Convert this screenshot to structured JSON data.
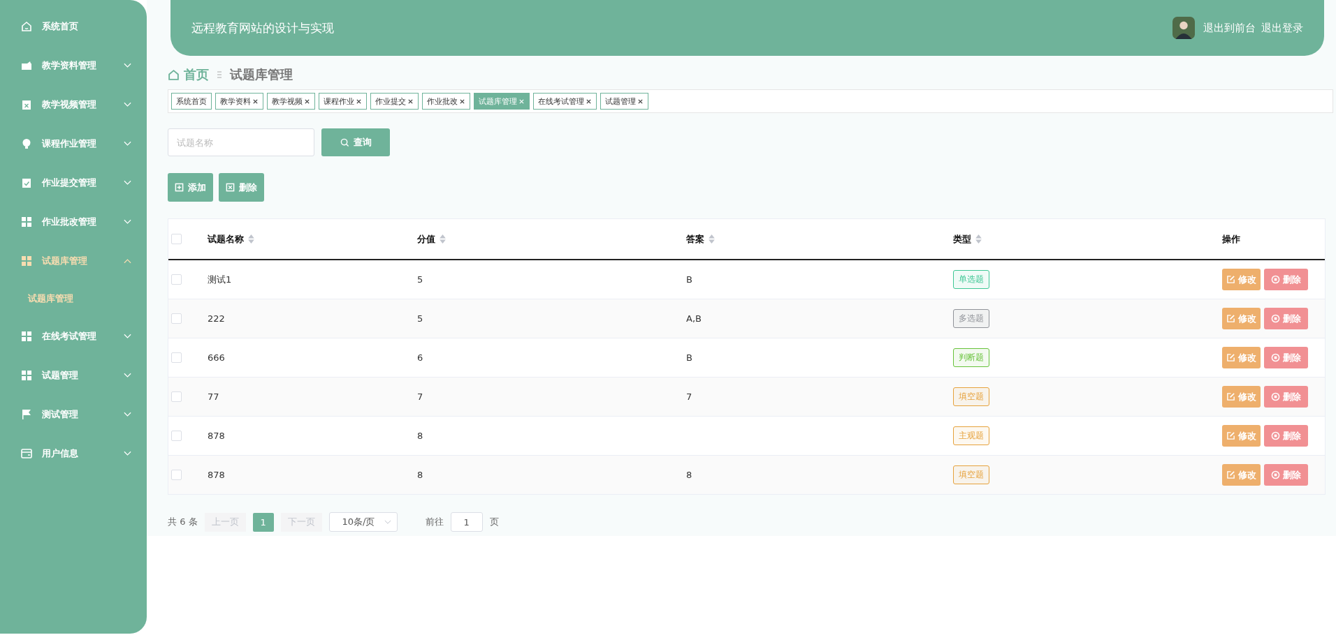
{
  "sidebar": {
    "items": [
      {
        "label": "系统首页",
        "selected": false
      },
      {
        "label": "教学资料管理",
        "selected": false,
        "expanded": false
      },
      {
        "label": "教学视频管理",
        "selected": false,
        "expanded": false
      },
      {
        "label": "课程作业管理",
        "selected": false,
        "expanded": false
      },
      {
        "label": "作业提交管理",
        "selected": false,
        "expanded": false
      },
      {
        "label": "作业批改管理",
        "selected": false,
        "expanded": false
      },
      {
        "label": "试题库管理",
        "selected": true,
        "expanded": true,
        "children": [
          {
            "label": "试题库管理",
            "selected": true
          }
        ]
      },
      {
        "label": "在线考试管理",
        "selected": false,
        "expanded": false
      },
      {
        "label": "试题管理",
        "selected": false,
        "expanded": false
      },
      {
        "label": "测试管理",
        "selected": false,
        "expanded": false
      },
      {
        "label": "用户信息",
        "selected": false,
        "expanded": false
      }
    ]
  },
  "header": {
    "title": "远程教育网站的设计与实现",
    "links": [
      "退出到前台",
      "退出登录"
    ]
  },
  "breadcrumb": {
    "home": "首页",
    "current": "试题库管理"
  },
  "tabs": [
    {
      "label": "系统首页",
      "selected": false,
      "closable": false
    },
    {
      "label": "教学资料",
      "selected": false,
      "closable": true
    },
    {
      "label": "教学视频",
      "selected": false,
      "closable": true
    },
    {
      "label": "课程作业",
      "selected": false,
      "closable": true
    },
    {
      "label": "作业提交",
      "selected": false,
      "closable": true
    },
    {
      "label": "作业批改",
      "selected": false,
      "closable": true
    },
    {
      "label": "试题库管理",
      "selected": true,
      "closable": true
    },
    {
      "label": "在线考试管理",
      "selected": false,
      "closable": true
    },
    {
      "label": "试题管理",
      "selected": false,
      "closable": true
    }
  ],
  "search": {
    "placeholder": "试题名称",
    "button": "查询"
  },
  "actions": [
    "添加",
    "删除"
  ],
  "table": {
    "all_checked": false,
    "columns": [
      {
        "label": "试题名称",
        "sortable": true
      },
      {
        "label": "分值",
        "sortable": true
      },
      {
        "label": "答案",
        "sortable": true
      },
      {
        "label": "类型",
        "sortable": true
      },
      {
        "label": "操作",
        "sortable": false
      }
    ],
    "rows": [
      {
        "checked": false,
        "name": "测试1",
        "score": "5",
        "answer": "B",
        "type": "单选题",
        "color": "#3ec795",
        "buttons": [
          "修改",
          "删除"
        ]
      },
      {
        "checked": false,
        "name": "222",
        "score": "5",
        "answer": "A,B",
        "type": "多选题",
        "color": "#909399",
        "buttons": [
          "修改",
          "删除"
        ]
      },
      {
        "checked": false,
        "name": "666",
        "score": "6",
        "answer": "B",
        "type": "判断题",
        "color": "#67c23a",
        "buttons": [
          "修改",
          "删除"
        ]
      },
      {
        "checked": false,
        "name": "77",
        "score": "7",
        "answer": "7",
        "type": "填空题",
        "color": "#e6a23c",
        "buttons": [
          "修改",
          "删除"
        ]
      },
      {
        "checked": false,
        "name": "878",
        "score": "8",
        "type": "主观题",
        "color": "#e6a23c",
        "buttons": [
          "修改",
          "删除"
        ]
      },
      {
        "checked": false,
        "name": "878",
        "score": "8",
        "answer": "8",
        "type": "填空题",
        "color": "#e6a23c",
        "buttons": [
          "修改",
          "删除"
        ]
      }
    ]
  },
  "pagination": {
    "total": "共 6 条",
    "prev": "上一页",
    "pages": [
      {
        "label": "1",
        "selected": true
      }
    ],
    "next": "下一页",
    "page_size": "10条/页",
    "goto": "前往",
    "goto_value": "1",
    "page_unit": "页"
  }
}
